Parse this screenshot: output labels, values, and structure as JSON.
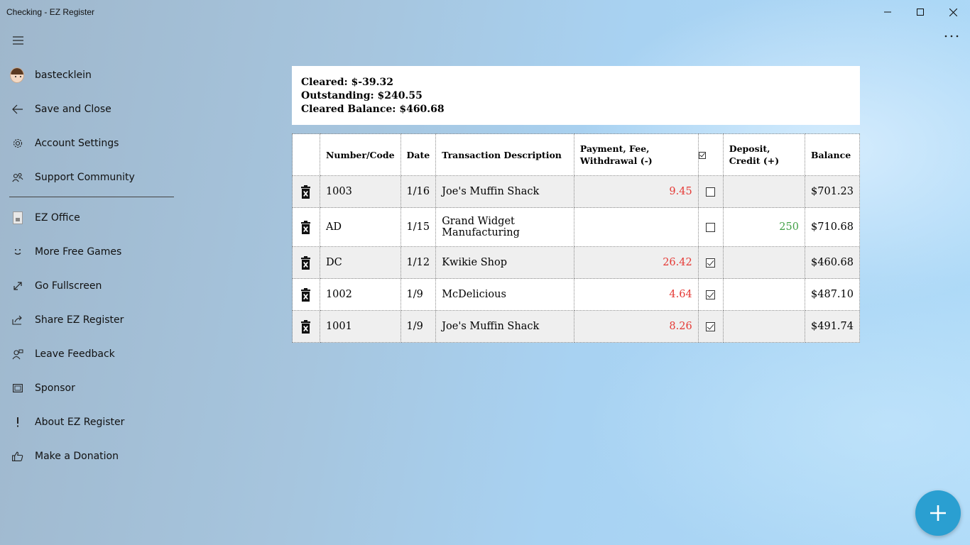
{
  "window": {
    "title": "Checking - EZ Register"
  },
  "sidebar": {
    "user": "bastecklein",
    "items": [
      {
        "label": "Save and Close",
        "icon": "back-arrow-icon"
      },
      {
        "label": "Account Settings",
        "icon": "gear-icon"
      },
      {
        "label": "Support Community",
        "icon": "people-icon"
      },
      {
        "label": "EZ Office",
        "icon": "ez-office-icon"
      },
      {
        "label": "More Free Games",
        "icon": "smiley-icon"
      },
      {
        "label": "Go Fullscreen",
        "icon": "fullscreen-icon"
      },
      {
        "label": "Share EZ Register",
        "icon": "share-icon"
      },
      {
        "label": "Leave Feedback",
        "icon": "feedback-icon"
      },
      {
        "label": "Sponsor",
        "icon": "sponsor-icon"
      },
      {
        "label": "About EZ Register",
        "icon": "exclamation-icon"
      },
      {
        "label": "Make a Donation",
        "icon": "thumbs-up-icon"
      }
    ]
  },
  "summary": {
    "cleared": "Cleared: $-39.32",
    "outstanding": "Outstanding: $240.55",
    "cleared_balance": "Cleared Balance: $460.68"
  },
  "table": {
    "headers": {
      "number": "Number/Code",
      "date": "Date",
      "description": "Transaction Description",
      "payment": "Payment, Fee, Withdrawal (-)",
      "deposit": "Deposit, Credit (+)",
      "balance": "Balance"
    },
    "rows": [
      {
        "number": "1003",
        "date": "1/16",
        "description": "Joe's Muffin Shack",
        "payment": "9.45",
        "cleared": false,
        "deposit": "",
        "balance": "$701.23"
      },
      {
        "number": "AD",
        "date": "1/15",
        "description": "Grand Widget Manufacturing",
        "payment": "",
        "cleared": false,
        "deposit": "250",
        "balance": "$710.68"
      },
      {
        "number": "DC",
        "date": "1/12",
        "description": "Kwikie Shop",
        "payment": "26.42",
        "cleared": true,
        "deposit": "",
        "balance": "$460.68"
      },
      {
        "number": "1002",
        "date": "1/9",
        "description": "McDelicious",
        "payment": "4.64",
        "cleared": true,
        "deposit": "",
        "balance": "$487.10"
      },
      {
        "number": "1001",
        "date": "1/9",
        "description": "Joe's Muffin Shack",
        "payment": "8.26",
        "cleared": true,
        "deposit": "",
        "balance": "$491.74"
      }
    ]
  },
  "colors": {
    "payment": "#e53935",
    "deposit": "#43a047",
    "fab": "#2a9fd1"
  }
}
